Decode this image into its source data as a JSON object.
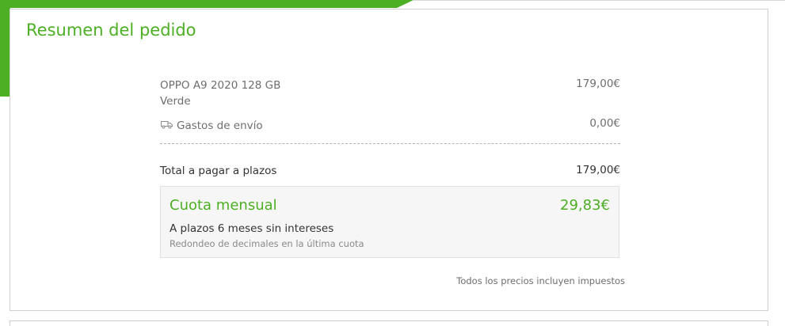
{
  "header": {
    "title": "Resumen del pedido"
  },
  "items": [
    {
      "name": "OPPO A9 2020 128 GB",
      "variant": "Verde",
      "price": "179,00€"
    }
  ],
  "shipping": {
    "label": "Gastos de envío",
    "icon": "truck-icon",
    "price": "0,00€"
  },
  "total": {
    "label": "Total a pagar a plazos",
    "amount": "179,00€"
  },
  "monthly": {
    "title": "Cuota mensual",
    "amount": "29,83€",
    "term": "A plazos 6 meses sin intereses",
    "note": "Redondeo de decimales en la última cuota"
  },
  "footer": {
    "taxes_note": "Todos los precios incluyen impuestos"
  },
  "colors": {
    "accent": "#4caf24",
    "text": "#333333",
    "muted": "#6e6e6e",
    "border": "#cfcfcf",
    "box_bg": "#f6f6f6"
  }
}
